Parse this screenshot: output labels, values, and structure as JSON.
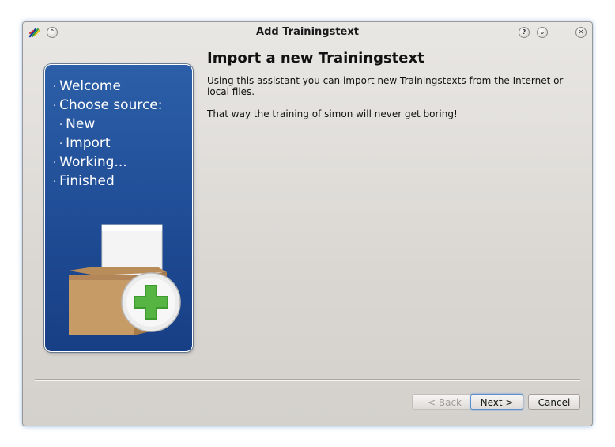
{
  "window": {
    "title": "Add Trainingstext",
    "buttons": {
      "help": "?",
      "minimize": "⌄",
      "close": "✕",
      "shade": "⌃"
    }
  },
  "sidebar": {
    "steps": [
      {
        "label": "Welcome",
        "level": 0
      },
      {
        "label": "Choose source:",
        "level": 0
      },
      {
        "label": "New",
        "level": 1
      },
      {
        "label": "Import",
        "level": 1
      },
      {
        "label": "Working...",
        "level": 0
      },
      {
        "label": "Finished",
        "level": 0
      }
    ],
    "bullet": "·"
  },
  "page": {
    "title": "Import a new Trainingstext",
    "description": "Using this assistant you can import new Trainingstexts from the Internet or local files.",
    "note": "That way the training of simon will never get boring!"
  },
  "footer": {
    "back": {
      "mnemonic": "B",
      "rest": "ack",
      "prefix": "< "
    },
    "next": {
      "mnemonic": "N",
      "rest": "ext >"
    },
    "cancel": {
      "mnemonic": "C",
      "rest": "ancel"
    }
  },
  "colors": {
    "panel_top": "#2c5fa8",
    "panel_bottom": "#173f85",
    "accent": "#5a8fd0"
  },
  "icons": [
    "app-icon",
    "shade-icon",
    "help-icon",
    "minimize-icon",
    "close-icon",
    "import-box-icon"
  ]
}
